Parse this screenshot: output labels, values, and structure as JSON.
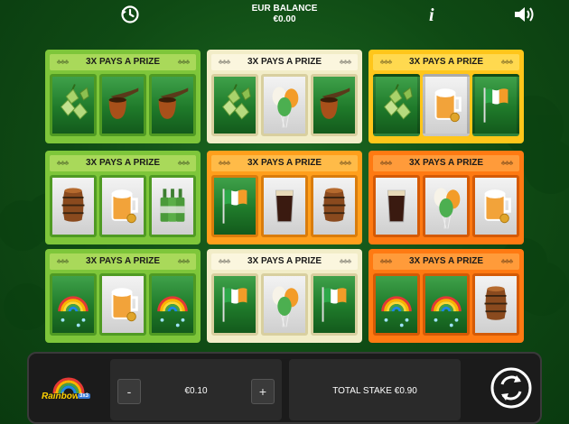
{
  "balance": {
    "label": "EUR BALANCE",
    "amount": "€0.00"
  },
  "ticket_banner": "3X PAYS A PRIZE",
  "tickets": [
    {
      "theme": "green",
      "symbols": [
        "hops",
        "pipe",
        "pipe"
      ]
    },
    {
      "theme": "cream",
      "symbols": [
        "hops",
        "balloons",
        "pipe"
      ]
    },
    {
      "theme": "gold",
      "symbols": [
        "hops",
        "beer",
        "flag"
      ]
    },
    {
      "theme": "green",
      "symbols": [
        "barrel",
        "beer",
        "bottles"
      ]
    },
    {
      "theme": "orange",
      "symbols": [
        "flag",
        "stout",
        "barrel"
      ]
    },
    {
      "theme": "deep",
      "symbols": [
        "stout",
        "balloons",
        "beer"
      ]
    },
    {
      "theme": "green",
      "symbols": [
        "rainbow",
        "beer",
        "rainbow"
      ]
    },
    {
      "theme": "cream",
      "symbols": [
        "flag",
        "balloons",
        "flag"
      ]
    },
    {
      "theme": "deep",
      "symbols": [
        "rainbow",
        "rainbow",
        "barrel"
      ]
    }
  ],
  "bottom": {
    "logo_text": "Rainbow",
    "logo_badge": "3x3",
    "minus_label": "-",
    "plus_label": "+",
    "stake_value": "€0.10",
    "total_stake": "TOTAL STAKE €0.90"
  },
  "icons": {
    "history": "history-icon",
    "info": "info-icon",
    "sound": "sound-icon",
    "play": "replay-icon"
  },
  "colors": {
    "background": "#0f4a14",
    "green_ticket": "#7ec63a",
    "cream_ticket": "#f2edc8",
    "orange_ticket": "#ff9f1c",
    "deep_orange_ticket": "#ff7a12",
    "gold_ticket": "#ffc61a"
  }
}
